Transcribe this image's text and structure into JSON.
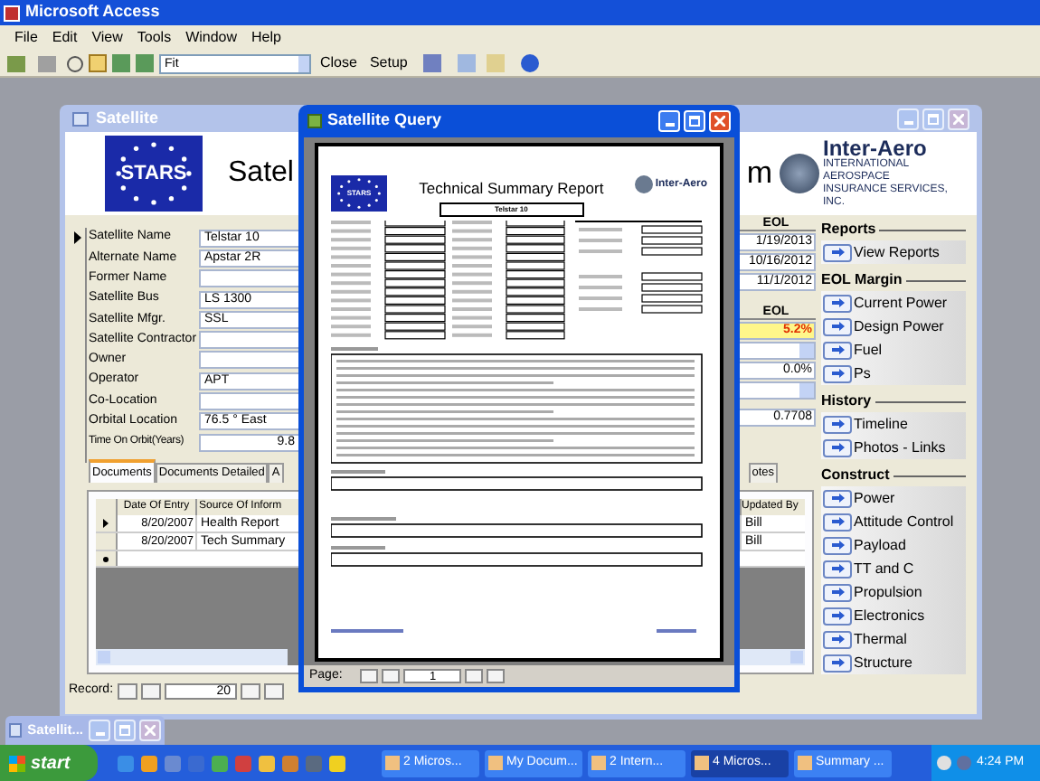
{
  "app": {
    "title": "Microsoft Access"
  },
  "menu": [
    "File",
    "Edit",
    "View",
    "Tools",
    "Window",
    "Help"
  ],
  "toolbar": {
    "zoom": "Fit",
    "buttons": [
      "Close",
      "Setup"
    ]
  },
  "satellite_window": {
    "title": "Satellite",
    "logo": "STARS",
    "heading_left": "Satel",
    "heading_right": "m",
    "brand": "Inter-Aero",
    "brand_subtitle": "INTERNATIONAL AEROSPACE INSURANCE SERVICES, INC.",
    "fields": [
      {
        "label": "Satellite Name",
        "value": "Telstar 10"
      },
      {
        "label": "Alternate Name",
        "value": "Apstar 2R"
      },
      {
        "label": "Former Name"
      },
      {
        "label": "Satellite Bus",
        "value": "LS 1300"
      },
      {
        "label": "Satellite Mfgr.",
        "value": "SSL"
      },
      {
        "label": "Satellite Contractor"
      },
      {
        "label": "Owner"
      },
      {
        "label": "Operator",
        "value": "APT"
      },
      {
        "label": "Co-Location"
      },
      {
        "label": "Orbital Location",
        "value": "76.5 ° East"
      }
    ],
    "time_on_orbit": {
      "label": "Time On Orbit(Years)",
      "value": "9.8"
    },
    "tabs": [
      {
        "label": "Documents",
        "selected": true
      },
      {
        "label": "Documents Detailed",
        "selected": false
      },
      {
        "label": "A",
        "selected": false
      },
      {
        "label": "otes",
        "selected": false
      }
    ],
    "documents": {
      "columns": [
        "Date Of Entry",
        "Source Of Inform",
        "Updated By"
      ],
      "rows": [
        {
          "selected": true,
          "cells": [
            "8/20/2007",
            "Health Report",
            "Bill"
          ]
        },
        {
          "selected": false,
          "cells": [
            "8/20/2007",
            "Tech Summary",
            "Bill"
          ]
        }
      ]
    },
    "eol": {
      "header": "EOL",
      "dates": [
        "1/19/2013",
        "10/16/2012",
        "11/1/2012"
      ]
    },
    "margin": {
      "header": "EOL",
      "percent_1": "5.2%",
      "percent_2": "0.0%",
      "ratio": "0.7708"
    },
    "record_nav": {
      "label": "Record:",
      "value": "20"
    },
    "side_panel": [
      {
        "title": "Reports",
        "buttons": [
          "View Reports"
        ]
      },
      {
        "title": "EOL Margin",
        "buttons": [
          "Current Power",
          "Design Power",
          "Fuel",
          "Ps"
        ]
      },
      {
        "title": "History",
        "buttons": [
          "Timeline",
          "Photos - Links"
        ]
      },
      {
        "title": "Construct",
        "buttons": [
          "Power",
          "Attitude Control",
          "Payload",
          "TT and C",
          "Propulsion",
          "Electronics",
          "Thermal",
          "Structure"
        ]
      }
    ]
  },
  "query_window": {
    "title": "Satellite Query",
    "report": {
      "logo": "STARS",
      "title": "Technical Summary Report",
      "satellite": "Telstar 10",
      "brand": "Inter-Aero"
    },
    "page_nav": {
      "label": "Page:",
      "value": "1"
    }
  },
  "minimized_window": {
    "title": "Satellit..."
  },
  "taskbar": {
    "start": "start",
    "tasks": [
      {
        "label": "2 Micros...",
        "selected": false
      },
      {
        "label": "My Docum...",
        "selected": false
      },
      {
        "label": "2 Intern...",
        "selected": false
      },
      {
        "label": "4 Micros...",
        "selected": true
      },
      {
        "label": "Summary ...",
        "selected": false
      }
    ],
    "clock": "4:24 PM"
  }
}
